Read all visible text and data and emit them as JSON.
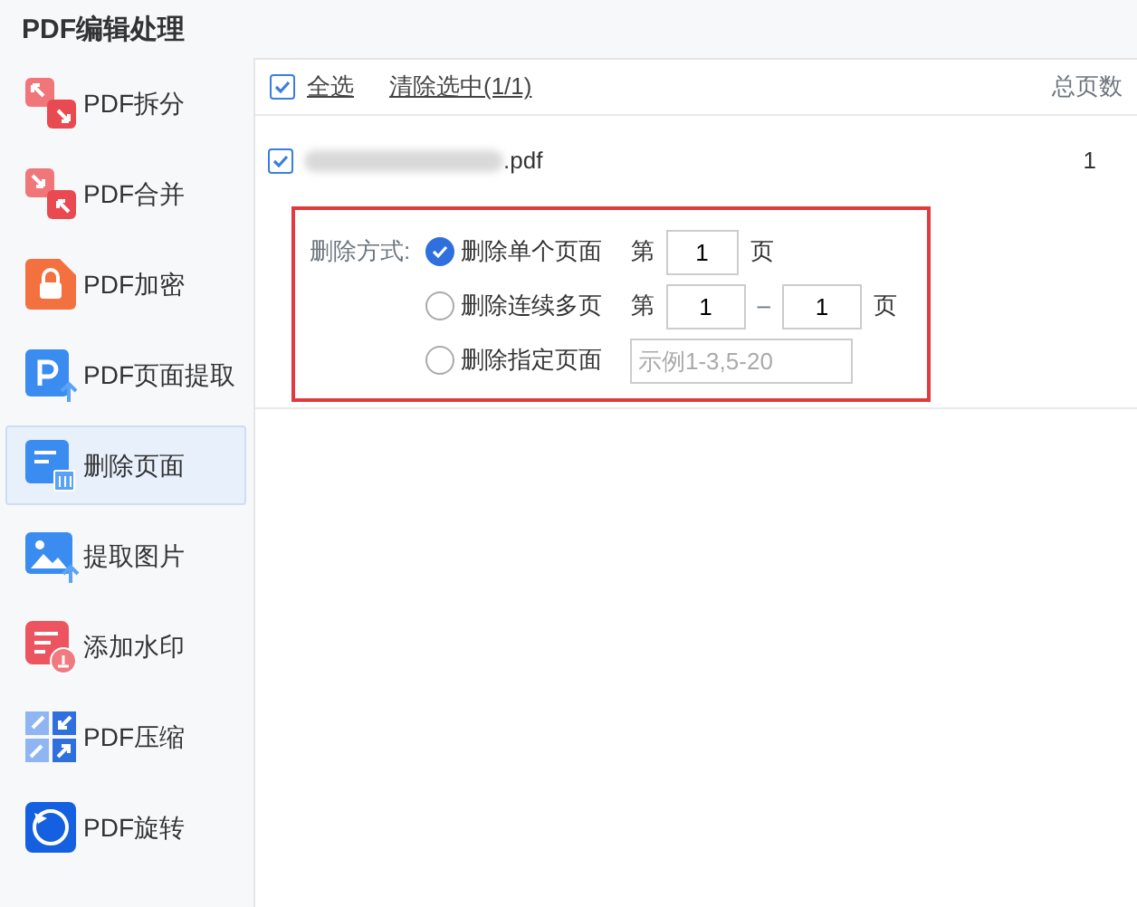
{
  "title": "PDF编辑处理",
  "sidebar": {
    "items": [
      {
        "label": "PDF拆分",
        "kind": "split",
        "selected": false
      },
      {
        "label": "PDF合并",
        "kind": "merge",
        "selected": false
      },
      {
        "label": "PDF加密",
        "kind": "encrypt",
        "selected": false
      },
      {
        "label": "PDF页面提取",
        "kind": "extract",
        "selected": false
      },
      {
        "label": "删除页面",
        "kind": "delete",
        "selected": true
      },
      {
        "label": "提取图片",
        "kind": "image",
        "selected": false
      },
      {
        "label": "添加水印",
        "kind": "watermark",
        "selected": false
      },
      {
        "label": "PDF压缩",
        "kind": "compress",
        "selected": false
      },
      {
        "label": "PDF旋转",
        "kind": "rotate",
        "selected": false
      }
    ]
  },
  "toolbar": {
    "select_all": {
      "label": "全选",
      "checked": true
    },
    "clear": "清除选中(1/1)",
    "column": "总页数"
  },
  "files": [
    {
      "name": ".pdf",
      "checked": true,
      "pages": "1"
    }
  ],
  "delete_options": {
    "label": "删除方式:",
    "options": [
      {
        "kind": "single",
        "label": "删除单个页面",
        "selected": true,
        "prefix": "第",
        "values": [
          "1"
        ],
        "suffix": "页"
      },
      {
        "kind": "range",
        "label": "删除连续多页",
        "selected": false,
        "prefix": "第",
        "values": [
          "1",
          "1"
        ],
        "separator": "–",
        "suffix": "页"
      },
      {
        "kind": "custom",
        "label": "删除指定页面",
        "selected": false,
        "placeholder": "示例1-3,5-20"
      }
    ]
  }
}
